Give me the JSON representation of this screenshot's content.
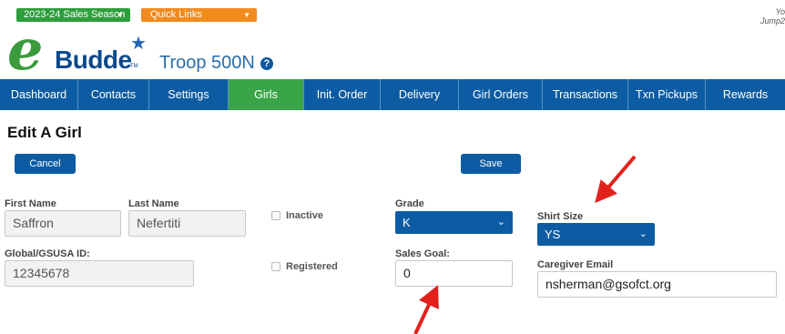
{
  "topbar": {
    "season_label": "2023-24 Sales Season",
    "quick_links_label": "Quick Links",
    "user_line1": "Yo",
    "user_line2": "Jump2"
  },
  "logo": {
    "letter": "e",
    "word": "Budde",
    "tm": "TM"
  },
  "troop": {
    "name": "Troop 500N",
    "help_glyph": "?"
  },
  "nav": {
    "items": [
      "Dashboard",
      "Contacts",
      "Settings",
      "Girls",
      "Init. Order",
      "Delivery",
      "Girl Orders",
      "Transactions",
      "Txn Pickups",
      "Rewards"
    ],
    "active": "Girls"
  },
  "page": {
    "title": "Edit A Girl",
    "cancel_label": "Cancel",
    "save_label": "Save"
  },
  "form": {
    "first_name_label": "First Name",
    "first_name_value": "Saffron",
    "last_name_label": "Last Name",
    "last_name_value": "Nefertiti",
    "global_id_label": "Global/GSUSA ID:",
    "global_id_value": "12345678",
    "inactive_label": "Inactive",
    "registered_label": "Registered",
    "grade_label": "Grade",
    "grade_value": "K",
    "sales_goal_label": "Sales Goal:",
    "sales_goal_value": "0",
    "shirt_size_label": "Shirt Size",
    "shirt_size_value": "YS",
    "caregiver_email_label": "Caregiver Email",
    "caregiver_email_value": "nsherman@gsofct.org"
  },
  "colors": {
    "nav_blue": "#0d5ca3",
    "active_green": "#3aa548",
    "arrow_red": "#e3211c"
  }
}
